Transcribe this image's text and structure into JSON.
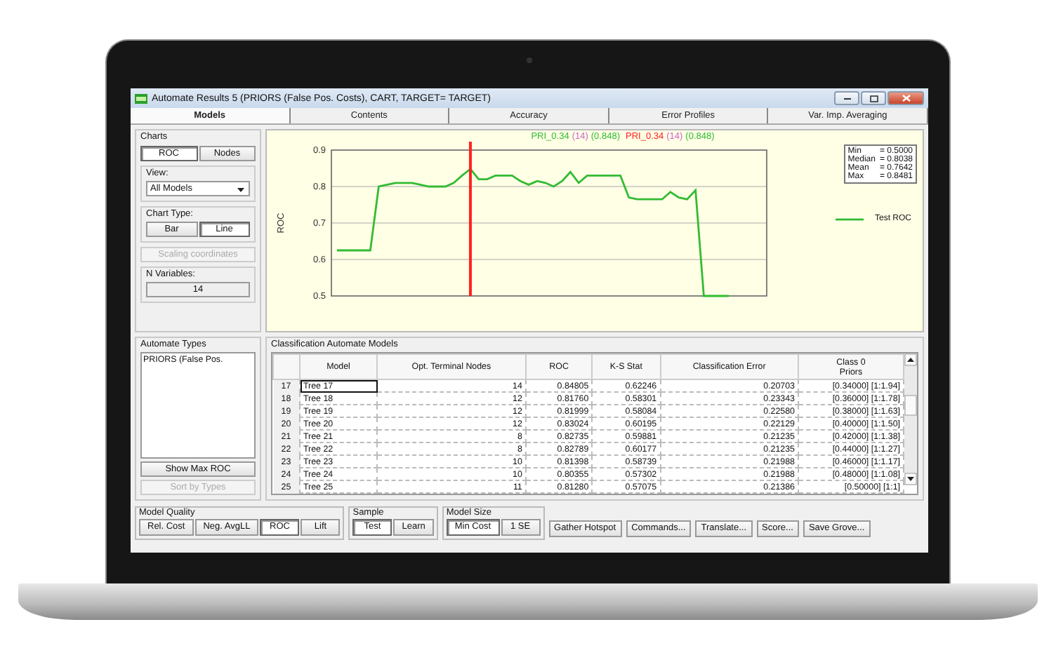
{
  "window": {
    "title": "Automate Results 5 (PRIORS (False Pos. Costs), CART, TARGET= TARGET)"
  },
  "tabs": [
    {
      "label": "Models",
      "selected": true
    },
    {
      "label": "Contents",
      "selected": false
    },
    {
      "label": "Accuracy",
      "selected": false
    },
    {
      "label": "Error Profiles",
      "selected": false
    },
    {
      "label": "Var. Imp. Averaging",
      "selected": false
    }
  ],
  "charts_group": {
    "title": "Charts",
    "buttons": [
      {
        "label": "ROC",
        "selected": true
      },
      {
        "label": "Nodes",
        "selected": false
      }
    ],
    "view_label": "View:",
    "view_value": "All Models",
    "chart_type_label": "Chart Type:",
    "chart_type_buttons": [
      {
        "label": "Bar",
        "selected": false
      },
      {
        "label": "Line",
        "selected": true
      }
    ],
    "scaling_button": {
      "label": "Scaling coordinates",
      "disabled": true
    },
    "n_variables_label": "N Variables:",
    "n_variables_value": "14"
  },
  "automate_types": {
    "title": "Automate Types",
    "items": [
      "PRIORS (False Pos."
    ],
    "buttons": [
      {
        "label": "Show Max ROC",
        "disabled": false
      },
      {
        "label": "Sort by Types",
        "disabled": true
      }
    ]
  },
  "chart": {
    "marker_labels": [
      {
        "parts": [
          {
            "text": "PRI_0.34",
            "color": "#33bb33"
          },
          {
            "text": "(14)",
            "color": "#cc66cc"
          },
          {
            "text": "(0.848)",
            "color": "#33bb33"
          }
        ]
      },
      {
        "parts": [
          {
            "text": "PRI_0.34",
            "color": "#ff2222"
          },
          {
            "text": "(14)",
            "color": "#cc66cc"
          },
          {
            "text": "(0.848)",
            "color": "#33bb33"
          }
        ]
      }
    ],
    "stats": [
      {
        "label": "Min",
        "value": "= 0.5000"
      },
      {
        "label": "Median",
        "value": "= 0.8038"
      },
      {
        "label": "Mean",
        "value": "= 0.7642"
      },
      {
        "label": "Max",
        "value": "= 0.8481"
      }
    ],
    "chart_data": {
      "type": "line",
      "ylabel": "ROC",
      "ylim": [
        0.5,
        0.9
      ],
      "yticks": [
        0.5,
        0.6,
        0.7,
        0.8,
        0.9
      ],
      "grid": true,
      "series": [
        {
          "name": "Test ROC",
          "color": "#33bb33",
          "values": [
            0.625,
            0.625,
            0.625,
            0.625,
            0.625,
            0.8,
            0.805,
            0.81,
            0.81,
            0.81,
            0.805,
            0.8,
            0.8,
            0.8,
            0.81,
            0.83,
            0.848,
            0.82,
            0.82,
            0.83,
            0.83,
            0.83,
            0.815,
            0.805,
            0.815,
            0.81,
            0.8,
            0.815,
            0.84,
            0.81,
            0.83,
            0.83,
            0.83,
            0.83,
            0.83,
            0.77,
            0.765,
            0.765,
            0.765,
            0.765,
            0.785,
            0.77,
            0.765,
            0.79,
            0.5,
            0.5,
            0.5,
            0.5
          ]
        }
      ]
    }
  },
  "table": {
    "title": "Classification Automate Models",
    "columns": [
      "Model",
      "Opt. Terminal Nodes",
      "ROC",
      "K-S Stat",
      "Classification Error",
      "Class 0\nPriors"
    ],
    "rows": [
      {
        "index": "17",
        "selected": true,
        "cells": [
          "Tree 17",
          "14",
          "0.84805",
          "0.62246",
          "0.20703",
          "[0.34000]  [1:1.94]"
        ]
      },
      {
        "index": "18",
        "selected": false,
        "cells": [
          "Tree 18",
          "12",
          "0.81760",
          "0.58301",
          "0.23343",
          "[0.36000]  [1:1.78]"
        ]
      },
      {
        "index": "19",
        "selected": false,
        "cells": [
          "Tree 19",
          "12",
          "0.81999",
          "0.58084",
          "0.22580",
          "[0.38000]  [1:1.63]"
        ]
      },
      {
        "index": "20",
        "selected": false,
        "cells": [
          "Tree 20",
          "12",
          "0.83024",
          "0.60195",
          "0.22129",
          "[0.40000]  [1:1.50]"
        ]
      },
      {
        "index": "21",
        "selected": false,
        "cells": [
          "Tree 21",
          "8",
          "0.82735",
          "0.59881",
          "0.21235",
          "[0.42000]  [1:1.38]"
        ]
      },
      {
        "index": "22",
        "selected": false,
        "cells": [
          "Tree 22",
          "8",
          "0.82789",
          "0.60177",
          "0.21235",
          "[0.44000]  [1:1.27]"
        ]
      },
      {
        "index": "23",
        "selected": false,
        "cells": [
          "Tree 23",
          "10",
          "0.81398",
          "0.58739",
          "0.21988",
          "[0.46000]  [1:1.17]"
        ]
      },
      {
        "index": "24",
        "selected": false,
        "cells": [
          "Tree 24",
          "10",
          "0.80355",
          "0.57302",
          "0.21988",
          "[0.48000]  [1:1.08]"
        ]
      },
      {
        "index": "25",
        "selected": false,
        "cells": [
          "Tree 25",
          "11",
          "0.81280",
          "0.57075",
          "0.21386",
          "[0.50000]  [1:1]"
        ]
      }
    ]
  },
  "bottom_groups": [
    {
      "title": "Model Quality",
      "buttons": [
        {
          "label": "Rel. Cost",
          "selected": false
        },
        {
          "label": "Neg. AvgLL",
          "selected": false
        },
        {
          "label": "ROC",
          "selected": true
        },
        {
          "label": "Lift",
          "selected": false
        }
      ]
    },
    {
      "title": "Sample",
      "buttons": [
        {
          "label": "Test",
          "selected": true
        },
        {
          "label": "Learn",
          "selected": false
        }
      ]
    },
    {
      "title": "Model Size",
      "buttons": [
        {
          "label": "Min Cost",
          "selected": true
        },
        {
          "label": "1 SE",
          "selected": false
        }
      ]
    }
  ],
  "action_buttons": [
    "Gather Hotspot",
    "Commands...",
    "Translate...",
    "Score...",
    "Save Grove..."
  ]
}
